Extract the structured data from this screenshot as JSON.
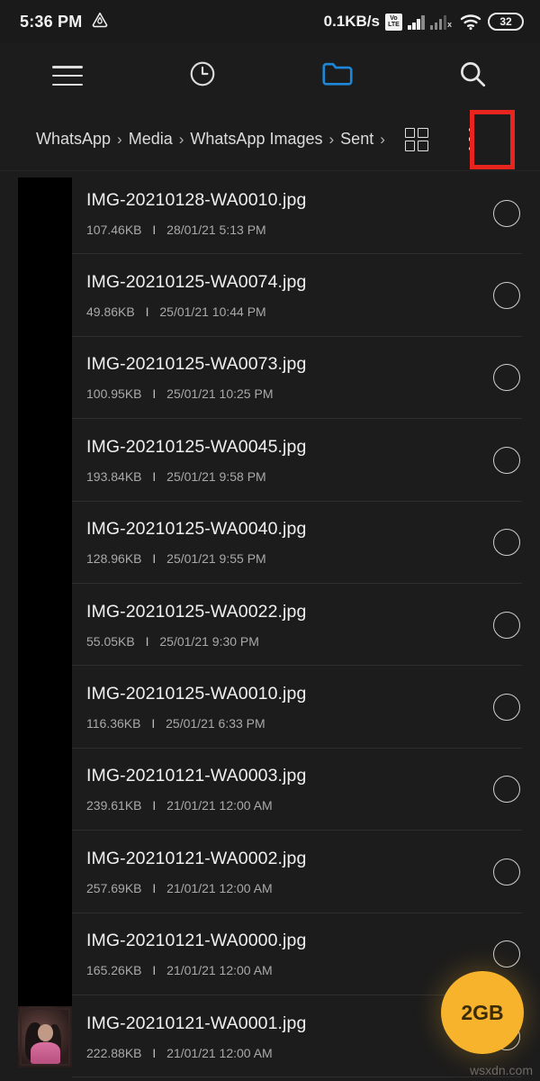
{
  "status_bar": {
    "time": "5:36 PM",
    "app_icon": "drive-triangle-icon",
    "network_speed": "0.1KB/s",
    "volte_top": "Vo",
    "volte_bottom": "LTE",
    "sim2_x": "x",
    "battery_level": "32"
  },
  "toolbar": {
    "menu_icon": "hamburger-menu-icon",
    "recent_icon": "clock-recent-icon",
    "folder_icon": "folder-icon",
    "search_icon": "search-icon",
    "folder_active_color": "#1e88d8"
  },
  "breadcrumb": {
    "items": [
      "WhatsApp",
      "Media",
      "WhatsApp Images",
      "Sent"
    ],
    "separator": "›",
    "trailing_separator": "›",
    "grid_view_icon": "grid-view-icon",
    "overflow_icon": "more-options-kebab-icon"
  },
  "annotation": {
    "color": "#e8241f",
    "target": "overflow-menu-button"
  },
  "files": [
    {
      "name": "IMG-20210128-WA0010.jpg",
      "size": "107.46KB",
      "sep": "I",
      "datetime": "28/01/21 5:13 PM",
      "thumb": "redacted"
    },
    {
      "name": "IMG-20210125-WA0074.jpg",
      "size": "49.86KB",
      "sep": "I",
      "datetime": "25/01/21 10:44 PM",
      "thumb": "redacted"
    },
    {
      "name": "IMG-20210125-WA0073.jpg",
      "size": "100.95KB",
      "sep": "I",
      "datetime": "25/01/21 10:25 PM",
      "thumb": "redacted"
    },
    {
      "name": "IMG-20210125-WA0045.jpg",
      "size": "193.84KB",
      "sep": "I",
      "datetime": "25/01/21 9:58 PM",
      "thumb": "redacted"
    },
    {
      "name": "IMG-20210125-WA0040.jpg",
      "size": "128.96KB",
      "sep": "I",
      "datetime": "25/01/21 9:55 PM",
      "thumb": "redacted"
    },
    {
      "name": "IMG-20210125-WA0022.jpg",
      "size": "55.05KB",
      "sep": "I",
      "datetime": "25/01/21 9:30 PM",
      "thumb": "redacted"
    },
    {
      "name": "IMG-20210125-WA0010.jpg",
      "size": "116.36KB",
      "sep": "I",
      "datetime": "25/01/21 6:33 PM",
      "thumb": "redacted"
    },
    {
      "name": "IMG-20210121-WA0003.jpg",
      "size": "239.61KB",
      "sep": "I",
      "datetime": "21/01/21 12:00 AM",
      "thumb": "redacted"
    },
    {
      "name": "IMG-20210121-WA0002.jpg",
      "size": "257.69KB",
      "sep": "I",
      "datetime": "21/01/21 12:00 AM",
      "thumb": "redacted"
    },
    {
      "name": "IMG-20210121-WA0000.jpg",
      "size": "165.26KB",
      "sep": "I",
      "datetime": "21/01/21 12:00 AM",
      "thumb": "redacted"
    },
    {
      "name": "IMG-20210121-WA0001.jpg",
      "size": "222.88KB",
      "sep": "I",
      "datetime": "21/01/21 12:00 AM",
      "thumb": "photo"
    }
  ],
  "fab": {
    "label": "2GB",
    "color": "#f7b32b"
  },
  "watermark": {
    "text": "wsxdn.com"
  }
}
